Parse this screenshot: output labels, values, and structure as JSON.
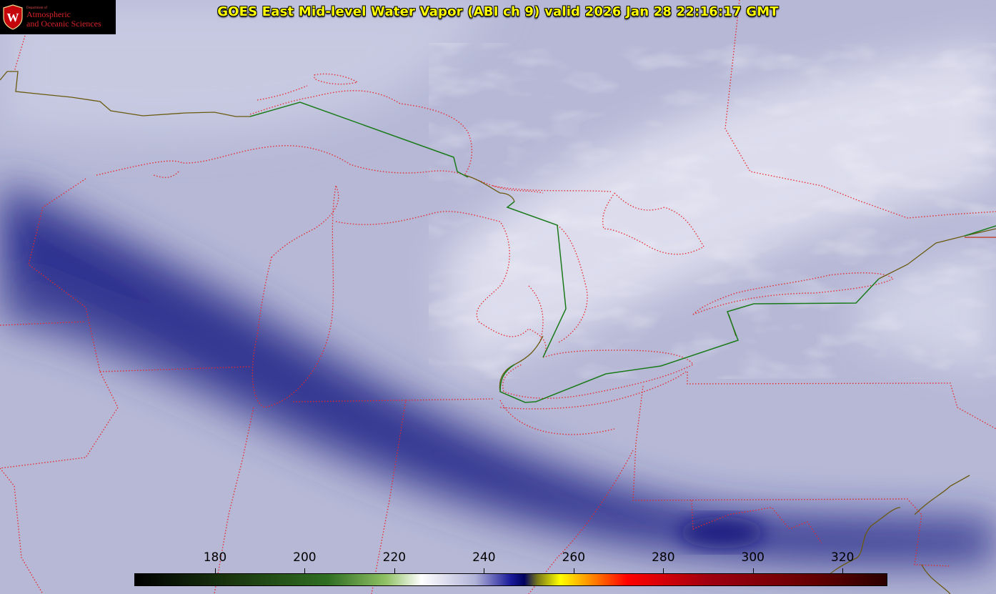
{
  "title": "GOES East Mid-level Water Vapor (ABI ch 9)  valid 2026 Jan 28 22:16:17 GMT",
  "logo": {
    "department": "Department of",
    "line1": "Atmospheric",
    "line2": "and Oceanic Sciences",
    "seal_letter": "W"
  },
  "colorbar": {
    "ticks": [
      "180",
      "200",
      "220",
      "240",
      "260",
      "280",
      "300",
      "320"
    ],
    "tick_values": [
      180,
      200,
      220,
      240,
      260,
      280,
      300,
      320
    ],
    "range": [
      162,
      330
    ],
    "stops": [
      {
        "v": 162,
        "c": "#000000"
      },
      {
        "v": 185,
        "c": "#1c3a10"
      },
      {
        "v": 205,
        "c": "#2f6e22"
      },
      {
        "v": 218,
        "c": "#8fc064"
      },
      {
        "v": 226,
        "c": "#ffffff"
      },
      {
        "v": 238,
        "c": "#b2b4d8"
      },
      {
        "v": 246,
        "c": "#1a1a9a"
      },
      {
        "v": 249,
        "c": "#000060"
      },
      {
        "v": 252,
        "c": "#7a7a1a"
      },
      {
        "v": 257,
        "c": "#ffff00"
      },
      {
        "v": 264,
        "c": "#ff8800"
      },
      {
        "v": 272,
        "c": "#ff0000"
      },
      {
        "v": 290,
        "c": "#a00010"
      },
      {
        "v": 315,
        "c": "#600000"
      },
      {
        "v": 330,
        "c": "#2a0000"
      }
    ]
  },
  "colors": {
    "state_border": "#e8262a",
    "intl_border": "#1a7a1a",
    "coastline": "#6a5a10",
    "title_text": "#ffff00",
    "dry_band": "#2a2c86",
    "moist_cloud": "#f2f2fa"
  }
}
